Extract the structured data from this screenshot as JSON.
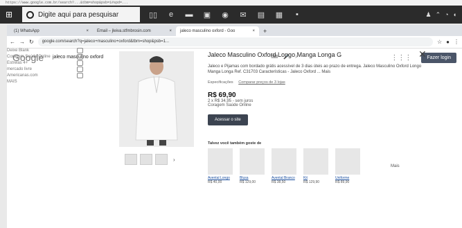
{
  "address_strip": "https://www.google.com.br/search?...&tbm=shop&psb=1#spd=...",
  "taskbar": {
    "search_placeholder": "Digite aqui para pesquisar"
  },
  "tabs": [
    {
      "label": "(1) WhatsApp"
    },
    {
      "label": "Email – jleiva.stfmbrosin.com"
    },
    {
      "label": "jaleco masculino oxford - Goo"
    }
  ],
  "omnibar": {
    "url": "google.com/search?q=jaleco+masculino+oxford&tbm=shop&psb=1..."
  },
  "google": {
    "logo": "Google",
    "query": "jaleco masculino oxford",
    "signin_label": "Fazer login"
  },
  "filters": [
    {
      "label": "Deixe Blank"
    },
    {
      "label": "Coragem Saúde Online"
    },
    {
      "label": "Estrelas 4+"
    },
    {
      "label": "mercado livre"
    },
    {
      "label": "Americanas.com"
    },
    {
      "label": "MAIS"
    }
  ],
  "product": {
    "title": "Jaleco Masculino Oxford Longo Manga Longa G",
    "description": "Jaleco e Pijamas com bordado grátis acessível de 3 dias úteis ao prazo de entrega. Jaleco Masculino Oxford Longo Manga Longa Ref. C31703 Características - Jaleco Oxford ... Mais",
    "specs_label": "Especificações",
    "compare_label": "Comparar preços de 3 lojas",
    "price": "R$ 69,90",
    "installments": "2 x R$ 34,95 - sem juros",
    "seller": "Coragem Saúde Online",
    "visit_label": "Acessar o site"
  },
  "related": {
    "title": "Talvez você também goste de",
    "items": [
      {
        "label": "Avental Longo",
        "price": "R$ 40,00"
      },
      {
        "label": "Blusa",
        "price": "R$ 129,00"
      },
      {
        "label": "Avental Branco",
        "price": "R$ 38,50"
      },
      {
        "label": "Kit",
        "price": "R$ 129,90"
      },
      {
        "label": "Uniforme",
        "price": "R$ 89,90"
      }
    ],
    "more_label": "Mais"
  },
  "colors": {
    "taskbar": "#2b2b2b",
    "visit_button": "#3c4451",
    "signin_button": "#4a5568"
  }
}
